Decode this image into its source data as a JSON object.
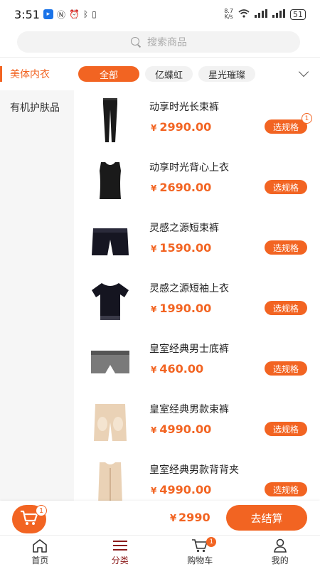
{
  "status_bar": {
    "time": "3:51",
    "speed_value": "8.7",
    "speed_unit": "K/s",
    "battery": "51"
  },
  "search": {
    "placeholder": "搜索商品"
  },
  "sidebar": {
    "items": [
      {
        "label": "美体内衣",
        "active": true
      },
      {
        "label": "有机护肤品",
        "active": false
      }
    ]
  },
  "filters": {
    "chips": [
      {
        "label": "全部",
        "active": true
      },
      {
        "label": "亿蝶虹",
        "active": false
      },
      {
        "label": "星光璀璨",
        "active": false
      }
    ]
  },
  "products": [
    {
      "name": "动享时光长束裤",
      "currency": "¥",
      "price": "2990.00",
      "button": "选规格",
      "badge": "1",
      "icon": "leggings-icon"
    },
    {
      "name": "动享时光背心上衣",
      "currency": "¥",
      "price": "2690.00",
      "button": "选规格",
      "badge": "",
      "icon": "vest-top-icon"
    },
    {
      "name": "灵感之源短束裤",
      "currency": "¥",
      "price": "1590.00",
      "button": "选规格",
      "badge": "",
      "icon": "shorts-icon"
    },
    {
      "name": "灵感之源短袖上衣",
      "currency": "¥",
      "price": "1990.00",
      "button": "选规格",
      "badge": "",
      "icon": "short-sleeve-top-icon"
    },
    {
      "name": "皇室经典男士底裤",
      "currency": "¥",
      "price": "460.00",
      "button": "选规格",
      "badge": "",
      "icon": "briefs-icon"
    },
    {
      "name": "皇室经典男款束裤",
      "currency": "¥",
      "price": "4990.00",
      "button": "选规格",
      "badge": "",
      "icon": "beige-shorts-icon"
    },
    {
      "name": "皇室经典男款背背夹",
      "currency": "¥",
      "price": "4990.00",
      "button": "选规格",
      "badge": "",
      "icon": "beige-vest-icon"
    }
  ],
  "cart": {
    "badge": "1",
    "currency": "¥",
    "total": "2990",
    "checkout_label": "去结算"
  },
  "tabbar": {
    "items": [
      {
        "label": "首页",
        "icon": "home-icon",
        "active": false,
        "badge": ""
      },
      {
        "label": "分类",
        "icon": "category-icon",
        "active": true,
        "badge": ""
      },
      {
        "label": "购物车",
        "icon": "cart-icon",
        "active": false,
        "badge": "1"
      },
      {
        "label": "我的",
        "icon": "profile-icon",
        "active": false,
        "badge": ""
      }
    ]
  },
  "colors": {
    "accent": "#f26422",
    "active_tab": "#8b1a1a",
    "sidebar_bg": "#f6f6f6"
  }
}
